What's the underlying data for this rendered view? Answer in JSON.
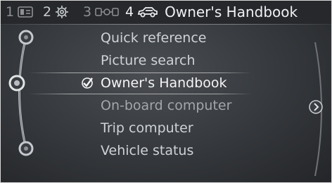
{
  "tabs": [
    {
      "number": "1",
      "icon": "media-icon"
    },
    {
      "number": "2",
      "icon": "settings-icon"
    },
    {
      "number": "3",
      "icon": "connectivity-icon"
    },
    {
      "number": "4",
      "icon": "vehicle-icon",
      "title": "Owner's Handbook"
    }
  ],
  "menu": {
    "items": [
      {
        "label": "Quick reference",
        "state": "normal"
      },
      {
        "label": "Picture search",
        "state": "normal"
      },
      {
        "label": "Owner's Handbook",
        "state": "selected"
      },
      {
        "label": "On-board computer",
        "state": "dim"
      },
      {
        "label": "Trip computer",
        "state": "normal"
      },
      {
        "label": "Vehicle status",
        "state": "normal"
      }
    ]
  },
  "controls": {
    "next_icon": "chevron-right-icon",
    "selected_icon": "checkmark-icon"
  },
  "colors": {
    "background": "#3a3d41",
    "text": "#cfd2d6",
    "selected_text": "#f4f5f6",
    "rail": "#bfc2c6"
  }
}
